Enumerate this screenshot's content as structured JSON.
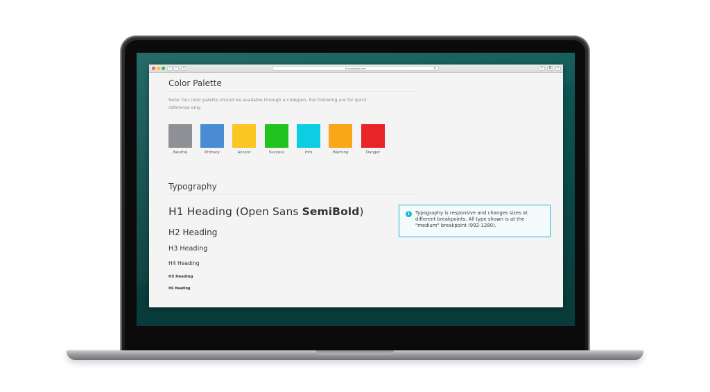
{
  "browser": {
    "url": "ki.nomotoro.com",
    "back_glyph": "‹",
    "forward_glyph": "›",
    "sidebar_glyph": "▯",
    "reload_glyph": "↻",
    "share_glyph": "⇪",
    "tabs_glyph": "⧉",
    "new_tab_glyph": "+"
  },
  "colors": {
    "neutral": "#8f9095",
    "primary": "#4a8bd6",
    "accent": "#f9c623",
    "success": "#21c31e",
    "info": "#0ccde2",
    "warning": "#f9a619",
    "danger": "#e82426",
    "callout_border": "#1bb6d1"
  },
  "palette": {
    "title": "Color Palette",
    "note": "Note: full color palette should be available through a codepen, the following are for quick reference only.",
    "swatches": [
      {
        "label": "Neutral",
        "color": "#8f9095"
      },
      {
        "label": "Primary",
        "color": "#4a8bd6"
      },
      {
        "label": "Accent",
        "color": "#f9c623"
      },
      {
        "label": "Success",
        "color": "#21c31e"
      },
      {
        "label": "Info",
        "color": "#0ccde2"
      },
      {
        "label": "Warning",
        "color": "#f9a619"
      },
      {
        "label": "Danger",
        "color": "#e82426"
      }
    ]
  },
  "typography": {
    "title": "Typography",
    "h1_prefix": "H1 Heading (Open Sans ",
    "h1_bold": "SemiBold",
    "h1_suffix": ")",
    "h2": "H2 Heading",
    "h3": "H3 Heading",
    "h4": "H4 Heading",
    "h5": "H5 Heading",
    "h6": "H6 Heading",
    "callout_icon": "i",
    "callout_text": "Typography is responsive and changes sizes at different breakpoints. All type shown is at the \"medium\" breakpoint (992-1280)."
  }
}
